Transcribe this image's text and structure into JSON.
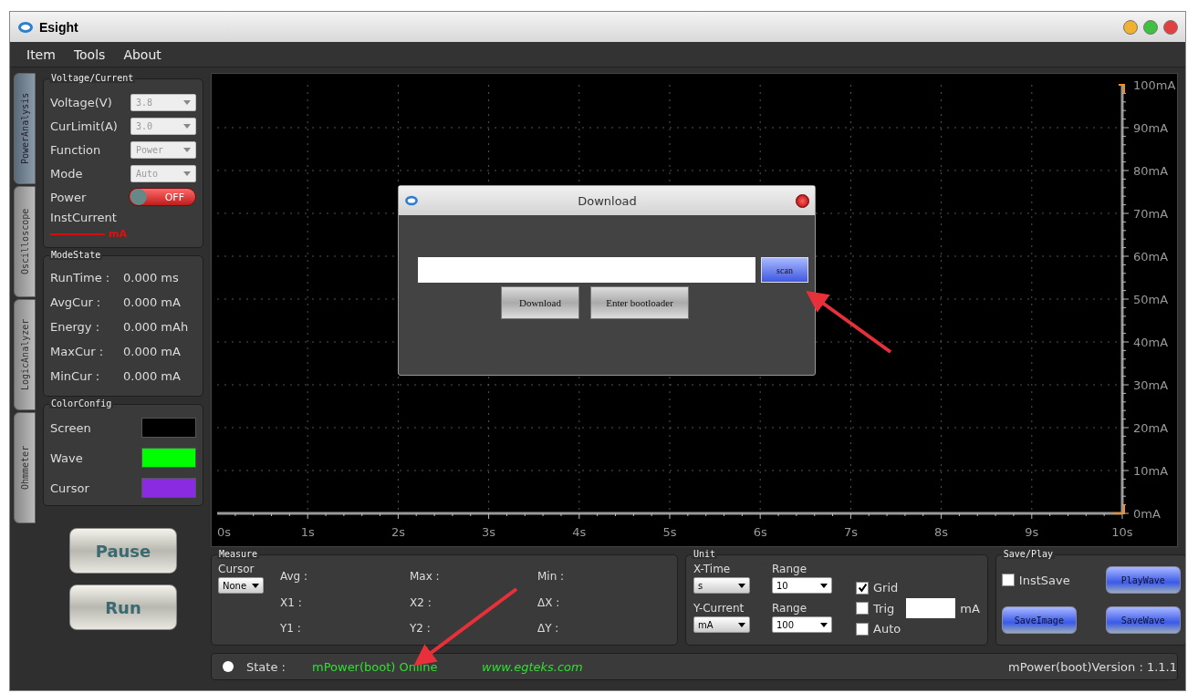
{
  "window": {
    "title": "Esight"
  },
  "menu": [
    "Item",
    "Tools",
    "About"
  ],
  "side_tabs": [
    {
      "label": "PowerAnalysis",
      "selected": true
    },
    {
      "label": "Oscilloscope",
      "selected": false
    },
    {
      "label": "LogicAnalyzer",
      "selected": false
    },
    {
      "label": "Ohmmeter",
      "selected": false
    }
  ],
  "voltage_current": {
    "title": "Voltage/Current",
    "fields": [
      {
        "label": "Voltage(V)",
        "value": "3.8"
      },
      {
        "label": "CurLimit(A)",
        "value": "3.0"
      },
      {
        "label": "Function",
        "value": "Power"
      },
      {
        "label": "Mode",
        "value": "Auto"
      }
    ],
    "power": {
      "label": "Power",
      "on": false,
      "text": "OFF"
    },
    "inst_current": {
      "label": "InstCurrent",
      "unit": "mA"
    }
  },
  "mode_state": {
    "title": "ModeState",
    "rows": [
      {
        "label": "RunTime :",
        "value": "0.000 ms"
      },
      {
        "label": "AvgCur :",
        "value": "0.000 mA"
      },
      {
        "label": "Energy :",
        "value": "0.000 mAh"
      },
      {
        "label": "MaxCur :",
        "value": "0.000 mA"
      },
      {
        "label": "MinCur :",
        "value": "0.000 mA"
      }
    ]
  },
  "color_config": {
    "title": "ColorConfig",
    "rows": [
      {
        "label": "Screen",
        "color": "#000000"
      },
      {
        "label": "Wave",
        "color": "#00ff00"
      },
      {
        "label": "Cursor",
        "color": "#8a2be2"
      }
    ]
  },
  "run_buttons": [
    "Pause",
    "Run"
  ],
  "chart": {
    "y_labels": [
      "100mA",
      "90mA",
      "80mA",
      "70mA",
      "60mA",
      "50mA",
      "40mA",
      "30mA",
      "20mA",
      "10mA",
      "0mA"
    ],
    "x_labels": [
      "0s",
      "1s",
      "2s",
      "3s",
      "4s",
      "5s",
      "6s",
      "7s",
      "8s",
      "9s",
      "10s"
    ]
  },
  "dialog": {
    "title": "Download",
    "scan": "scan",
    "buttons": [
      "Download",
      "Enter bootloader"
    ]
  },
  "measure": {
    "title": "Measure",
    "cursor_label": "Cursor",
    "cursor_value": "None",
    "labels": [
      "Avg :",
      "Max :",
      "Min :",
      "X1 :",
      "X2 :",
      "ΔX :",
      "Y1 :",
      "Y2 :",
      "ΔY :"
    ]
  },
  "unit": {
    "title": "Unit",
    "selects": [
      {
        "label": "X-Time",
        "value": "s",
        "kind": "grey"
      },
      {
        "label": "Range",
        "value": "10",
        "kind": "white"
      },
      {
        "label": "Y-Current",
        "value": "mA",
        "kind": "grey"
      },
      {
        "label": "Range",
        "value": "100",
        "kind": "white"
      }
    ],
    "checks": [
      {
        "label": "Grid",
        "checked": true
      },
      {
        "label": "Trig",
        "checked": false
      },
      {
        "label": "Auto",
        "checked": false
      }
    ],
    "trig_unit": "mA"
  },
  "save_play": {
    "title": "Save/Play",
    "inst_save": {
      "label": "InstSave",
      "checked": false
    },
    "buttons": [
      "PlayWave",
      "SaveImage",
      "SaveWave"
    ]
  },
  "status": {
    "label": "State :",
    "value": "mPower(boot) Online",
    "website": "www.egteks.com",
    "version": "mPower(boot)Version : 1.1.1"
  }
}
